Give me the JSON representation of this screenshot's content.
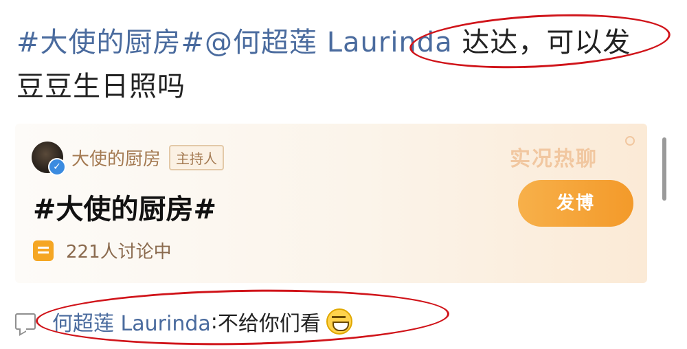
{
  "post": {
    "topic_tag": "#大使的厨房#",
    "mention": "@何超莲 Laurinda",
    "message_line1": " 达达，可以发",
    "message_line2": "豆豆生日照吗"
  },
  "card": {
    "host_name": "大使的厨房",
    "host_badge": "主持人",
    "topic": "#大使的厨房#",
    "discussion": "221人讨论中",
    "live_chat": "实况热聊",
    "post_button": "发博"
  },
  "comment": {
    "author": "何超莲 Laurinda",
    "separator": ": ",
    "text": "不给你们看"
  },
  "colors": {
    "link": "#4a6b9e",
    "accent_orange": "#f39a2a",
    "annotation_red": "#d0141a"
  }
}
